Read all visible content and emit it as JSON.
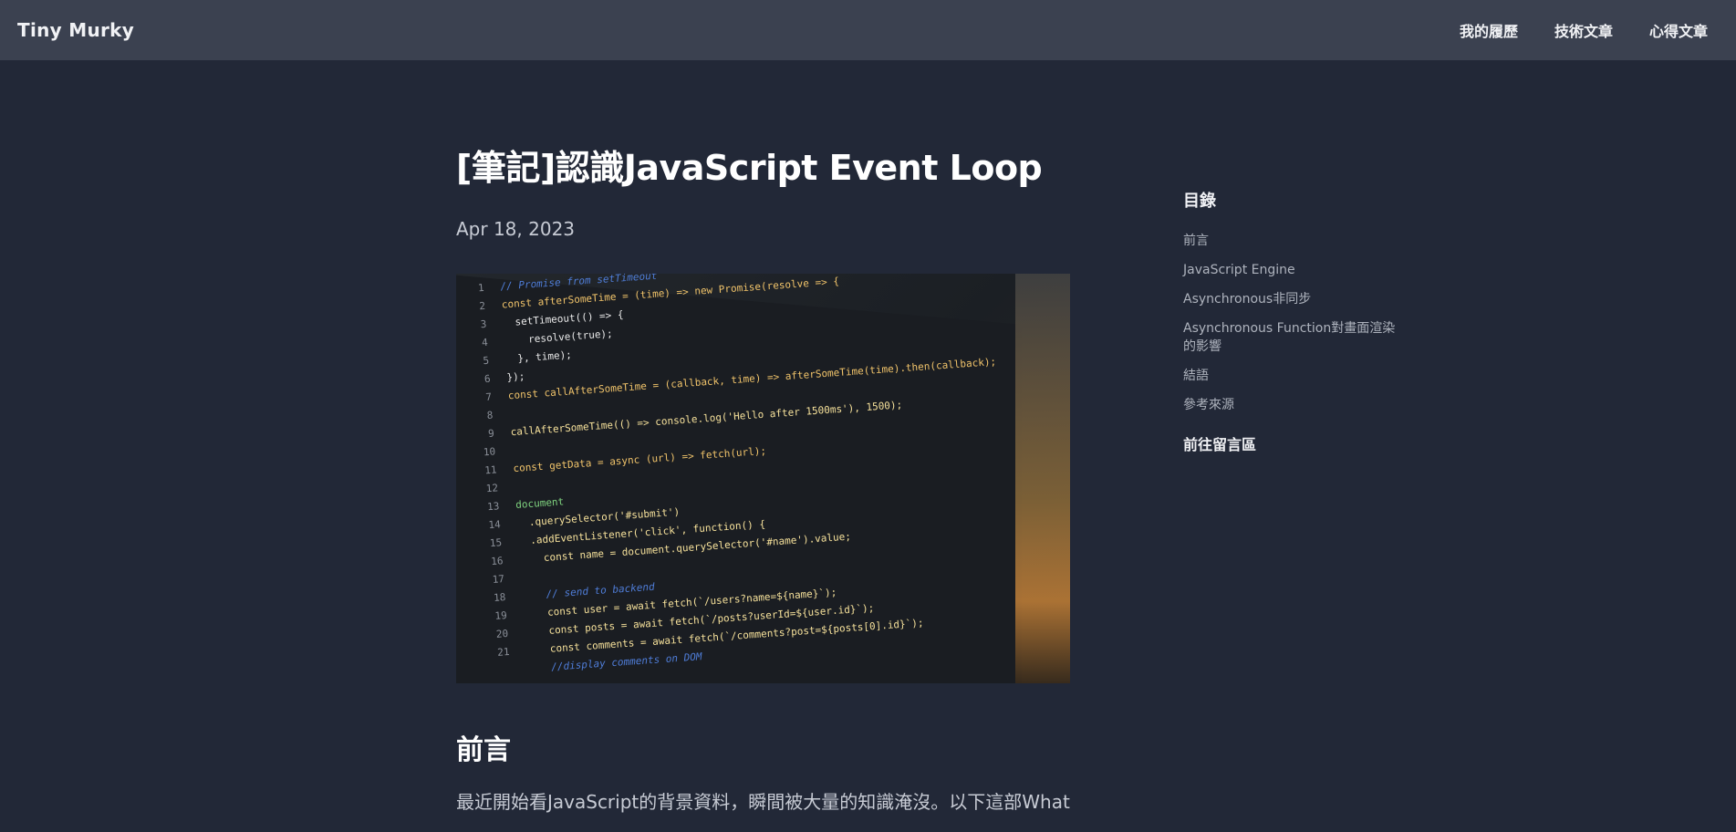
{
  "header": {
    "brand": "Tiny Murky",
    "nav": [
      "我的履歷",
      "技術文章",
      "心得文章"
    ]
  },
  "post": {
    "title": "[筆記]認識JavaScript Event Loop",
    "date": "Apr 18, 2023",
    "section_title": "前言",
    "paragraph": "最近開始看JavaScript的背景資料，瞬間被大量的知識淹沒。以下這部What"
  },
  "hero_code": [
    {
      "n": "1",
      "t": "// Promise from setTimeout",
      "c": "cmt"
    },
    {
      "n": "2",
      "t": "const afterSomeTime = (time) => new Promise(resolve => {",
      "c": "kw"
    },
    {
      "n": "3",
      "t": "  setTimeout(() => {",
      "c": ""
    },
    {
      "n": "4",
      "t": "    resolve(true);",
      "c": ""
    },
    {
      "n": "5",
      "t": "  }, time);",
      "c": ""
    },
    {
      "n": "6",
      "t": "});",
      "c": ""
    },
    {
      "n": "7",
      "t": "const callAfterSomeTime = (callback, time) => afterSomeTime(time).then(callback);",
      "c": "kw"
    },
    {
      "n": "8",
      "t": "",
      "c": ""
    },
    {
      "n": "9",
      "t": "callAfterSomeTime(() => console.log('Hello after 1500ms'), 1500);",
      "c": "fn"
    },
    {
      "n": "10",
      "t": "",
      "c": ""
    },
    {
      "n": "11",
      "t": "const getData = async (url) => fetch(url);",
      "c": "kw"
    },
    {
      "n": "12",
      "t": "",
      "c": ""
    },
    {
      "n": "13",
      "t": "document",
      "c": "grn"
    },
    {
      "n": "14",
      "t": "  .querySelector('#submit')",
      "c": "fn"
    },
    {
      "n": "15",
      "t": "  .addEventListener('click', function() {",
      "c": "fn"
    },
    {
      "n": "16",
      "t": "    const name = document.querySelector('#name').value;",
      "c": "fn"
    },
    {
      "n": "17",
      "t": "",
      "c": ""
    },
    {
      "n": "18",
      "t": "    // send to backend",
      "c": "cmt"
    },
    {
      "n": "19",
      "t": "    const user = await fetch(`/users?name=${name}`);",
      "c": "fn"
    },
    {
      "n": "20",
      "t": "    const posts = await fetch(`/posts?userId=${user.id}`);",
      "c": "fn"
    },
    {
      "n": "21",
      "t": "    const comments = await fetch(`/comments?post=${posts[0].id}`);",
      "c": "fn"
    },
    {
      "n": "",
      "t": "    //display comments on DOM",
      "c": "cmt"
    }
  ],
  "toc": {
    "title": "目錄",
    "items": [
      "前言",
      "JavaScript Engine",
      "Asynchronous非同步",
      "Asynchronous Function對畫面渲染的影響",
      "結語",
      "參考來源"
    ],
    "comment_link": "前往留言區"
  }
}
